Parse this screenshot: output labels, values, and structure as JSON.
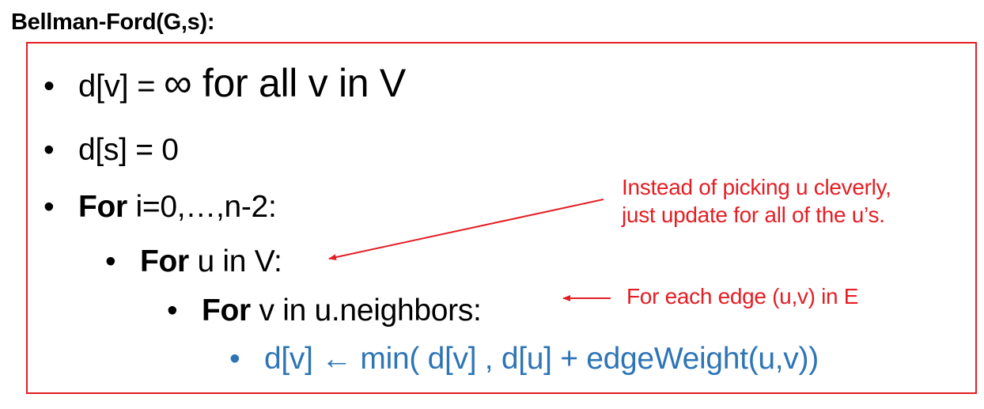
{
  "title": "Bellman-Ford(G,s):",
  "bullet": "•",
  "lines": {
    "l1": {
      "pre": "d[v] = ",
      "infinity": "∞",
      "post": " for all v in V"
    },
    "l2": {
      "text": "d[s] = 0"
    },
    "l3": {
      "keyword": "For",
      "rest": " i=0,…,n-2:"
    },
    "l4": {
      "keyword": "For",
      "rest": " u in V:"
    },
    "l5": {
      "keyword": "For",
      "rest": " v in u.neighbors:"
    },
    "l6": {
      "text": "d[v] ← min( d[v] , d[u] + edgeWeight(u,v))"
    }
  },
  "notes": {
    "note1_line1": "Instead of picking u cleverly,",
    "note1_line2": "just update for all of the u’s.",
    "note2": "For each edge (u,v) in E"
  },
  "colors": {
    "accent_red": "#e31e24",
    "code_blue": "#2e75b6"
  }
}
